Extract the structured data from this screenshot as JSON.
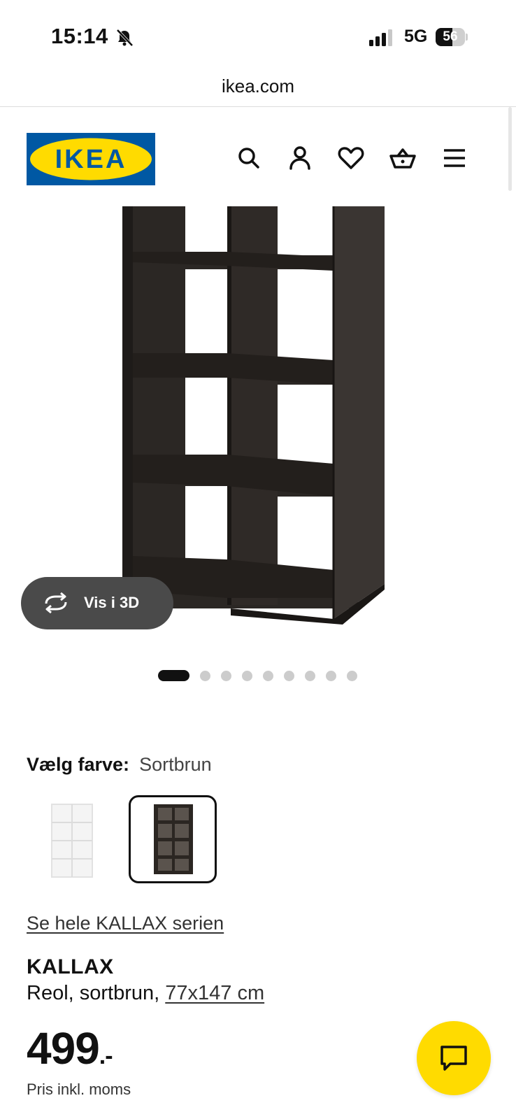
{
  "status_bar": {
    "time": "15:14",
    "network": "5G",
    "battery": "56",
    "battery_level": 0.56
  },
  "browser": {
    "url": "ikea.com"
  },
  "header": {
    "logo_text": "IKEA",
    "icons": [
      "search-icon",
      "account-icon",
      "heart-icon",
      "basket-icon",
      "menu-icon"
    ]
  },
  "gallery": {
    "view_3d_label": "Vis i 3D",
    "image_count": 9,
    "active_index": 0
  },
  "color_selector": {
    "label": "Vælg farve:",
    "selected_value": "Sortbrun",
    "options": [
      {
        "name": "white",
        "color": "#f2f2f2"
      },
      {
        "name": "black-brown",
        "color": "#2b2622",
        "selected": true
      }
    ]
  },
  "series_link": "Se hele KALLAX serien",
  "product": {
    "name": "KALLAX",
    "description": "Reol, sortbrun,",
    "size": "77x147 cm",
    "price": "499",
    "price_suffix": ".-",
    "price_note": "Pris inkl. moms"
  },
  "colors": {
    "brand_blue": "#0058a3",
    "brand_yellow": "#ffdb00",
    "dark": "#111111"
  }
}
